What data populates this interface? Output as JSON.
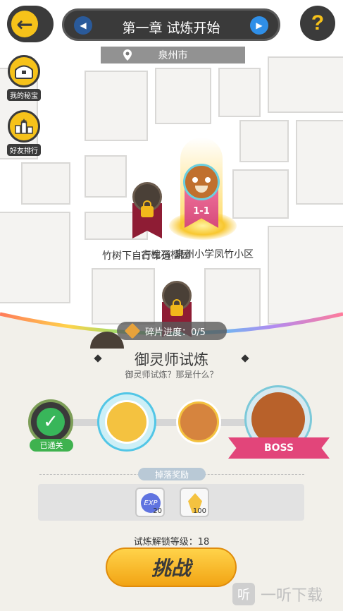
{
  "header": {
    "chapter_title": "第一章 试炼开始",
    "city": "泉州市",
    "help_label": "?"
  },
  "sidebar": {
    "items": [
      {
        "label": "我的秘宝",
        "icon": "treasure-chest-icon"
      },
      {
        "label": "好友排行",
        "icon": "leaderboard-icon"
      }
    ]
  },
  "map": {
    "places": [
      "竹树下自行车道",
      "古槐石榴园",
      "泉州小学凤竹小区"
    ],
    "current_stage": "1-1"
  },
  "fragment": {
    "label": "碎片进度：0/5"
  },
  "trial": {
    "title": "御灵师试炼",
    "subtitle": "御灵师试炼？那是什么？",
    "cleared_label": "已通关",
    "boss_label": "BOSS"
  },
  "rewards": {
    "title": "掉落奖励",
    "items": [
      {
        "icon": "exp-icon",
        "label": "EXP",
        "quantity": "20"
      },
      {
        "icon": "golden-shard-icon",
        "quantity": "100"
      }
    ]
  },
  "footer": {
    "unlock_level": "试炼解锁等级：18",
    "challenge_label": "挑战",
    "watermark": "一听下载"
  },
  "colors": {
    "accent_yellow": "#f6c21a",
    "dark": "#3b3b3b",
    "boss_pink": "#e2457a",
    "cleared_green": "#3fb24f"
  }
}
